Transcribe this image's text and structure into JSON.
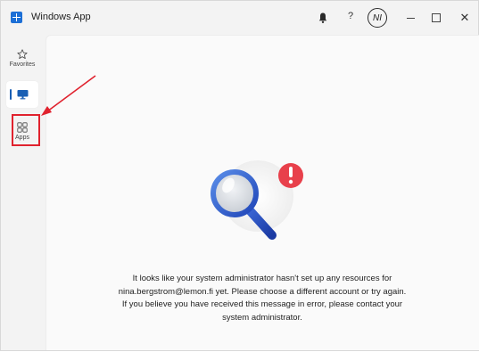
{
  "window": {
    "title": "Windows App",
    "help_label": "?",
    "avatar_initials": "NI",
    "close_label": "✕"
  },
  "sidebar": {
    "items": [
      {
        "label": "Favorites",
        "icon": "star-icon"
      },
      {
        "label": "",
        "icon": "monitor-icon",
        "active": true
      },
      {
        "label": "Apps",
        "icon": "apps-icon",
        "highlighted": true
      }
    ]
  },
  "main": {
    "message_lines": [
      "It looks like your system administrator hasn't set up any resources for",
      "nina.bergstrom@lemon.fi yet. Please choose a different account or try again.",
      "If you believe you have received this message in error, please contact your",
      "system administrator."
    ],
    "illustration": "magnifier-with-alert-icon"
  },
  "colors": {
    "accent": "#1a5fb4",
    "annotation": "#e0222e",
    "alert": "#e8404b"
  }
}
